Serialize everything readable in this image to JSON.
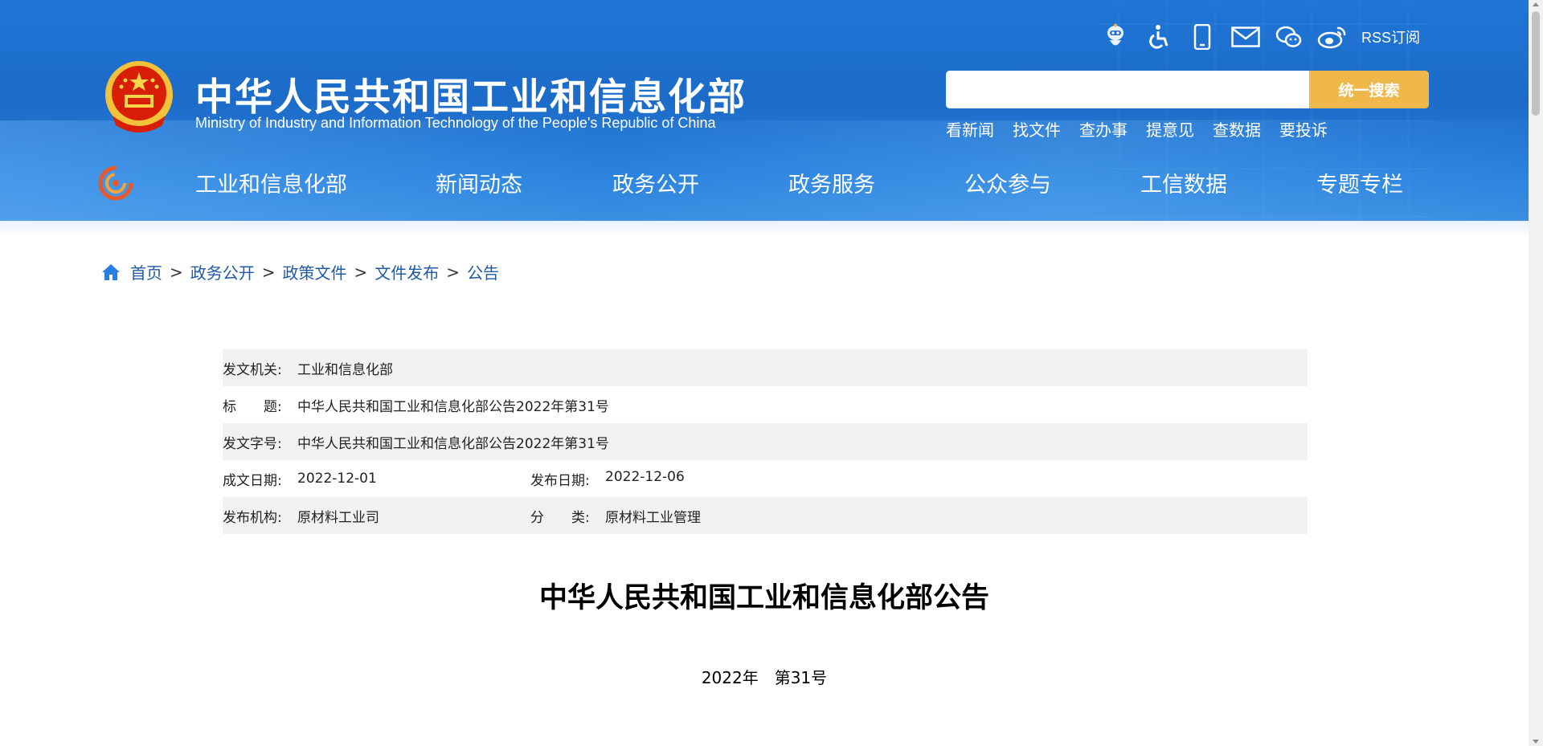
{
  "header": {
    "title": "中华人民共和国工业和信息化部",
    "subtitle": "Ministry of Industry and Information Technology of the People's Republic of China",
    "tool_icons": [
      "robot-assistant-icon",
      "accessibility-icon",
      "mobile-icon",
      "mail-icon",
      "wechat-icon",
      "weibo-icon"
    ],
    "rss_label": "RSS订阅",
    "search": {
      "placeholder": "",
      "button_label": "统一搜索"
    },
    "quick_links": [
      "看新闻",
      "找文件",
      "查办事",
      "提意见",
      "查数据",
      "要投诉"
    ],
    "nav": [
      "工业和信息化部",
      "新闻动态",
      "政务公开",
      "政务服务",
      "公众参与",
      "工信数据",
      "专题专栏"
    ]
  },
  "breadcrumb": [
    "首页",
    "政务公开",
    "政策文件",
    "文件发布",
    "公告"
  ],
  "meta": {
    "issuer_label": "发文机关:",
    "issuer": "工业和信息化部",
    "title_label": "标　　题:",
    "title": "中华人民共和国工业和信息化部公告2022年第31号",
    "doc_no_label": "发文字号:",
    "doc_no": "中华人民共和国工业和信息化部公告2022年第31号",
    "written_date_label": "成文日期:",
    "written_date": "2022-12-01",
    "publish_date_label": "发布日期:",
    "publish_date": "2022-12-06",
    "publisher_label": "发布机构:",
    "publisher": "原材料工业司",
    "category_label": "分　　类:",
    "category": "原材料工业管理"
  },
  "document": {
    "heading": "中华人民共和国工业和信息化部公告",
    "number": "2022年　第31号"
  },
  "colors": {
    "header_blue": "#1f76d6",
    "search_button": "#f0b74a",
    "breadcrumb_link": "#1f5aa6",
    "meta_stripe": "#f1f1f1"
  }
}
